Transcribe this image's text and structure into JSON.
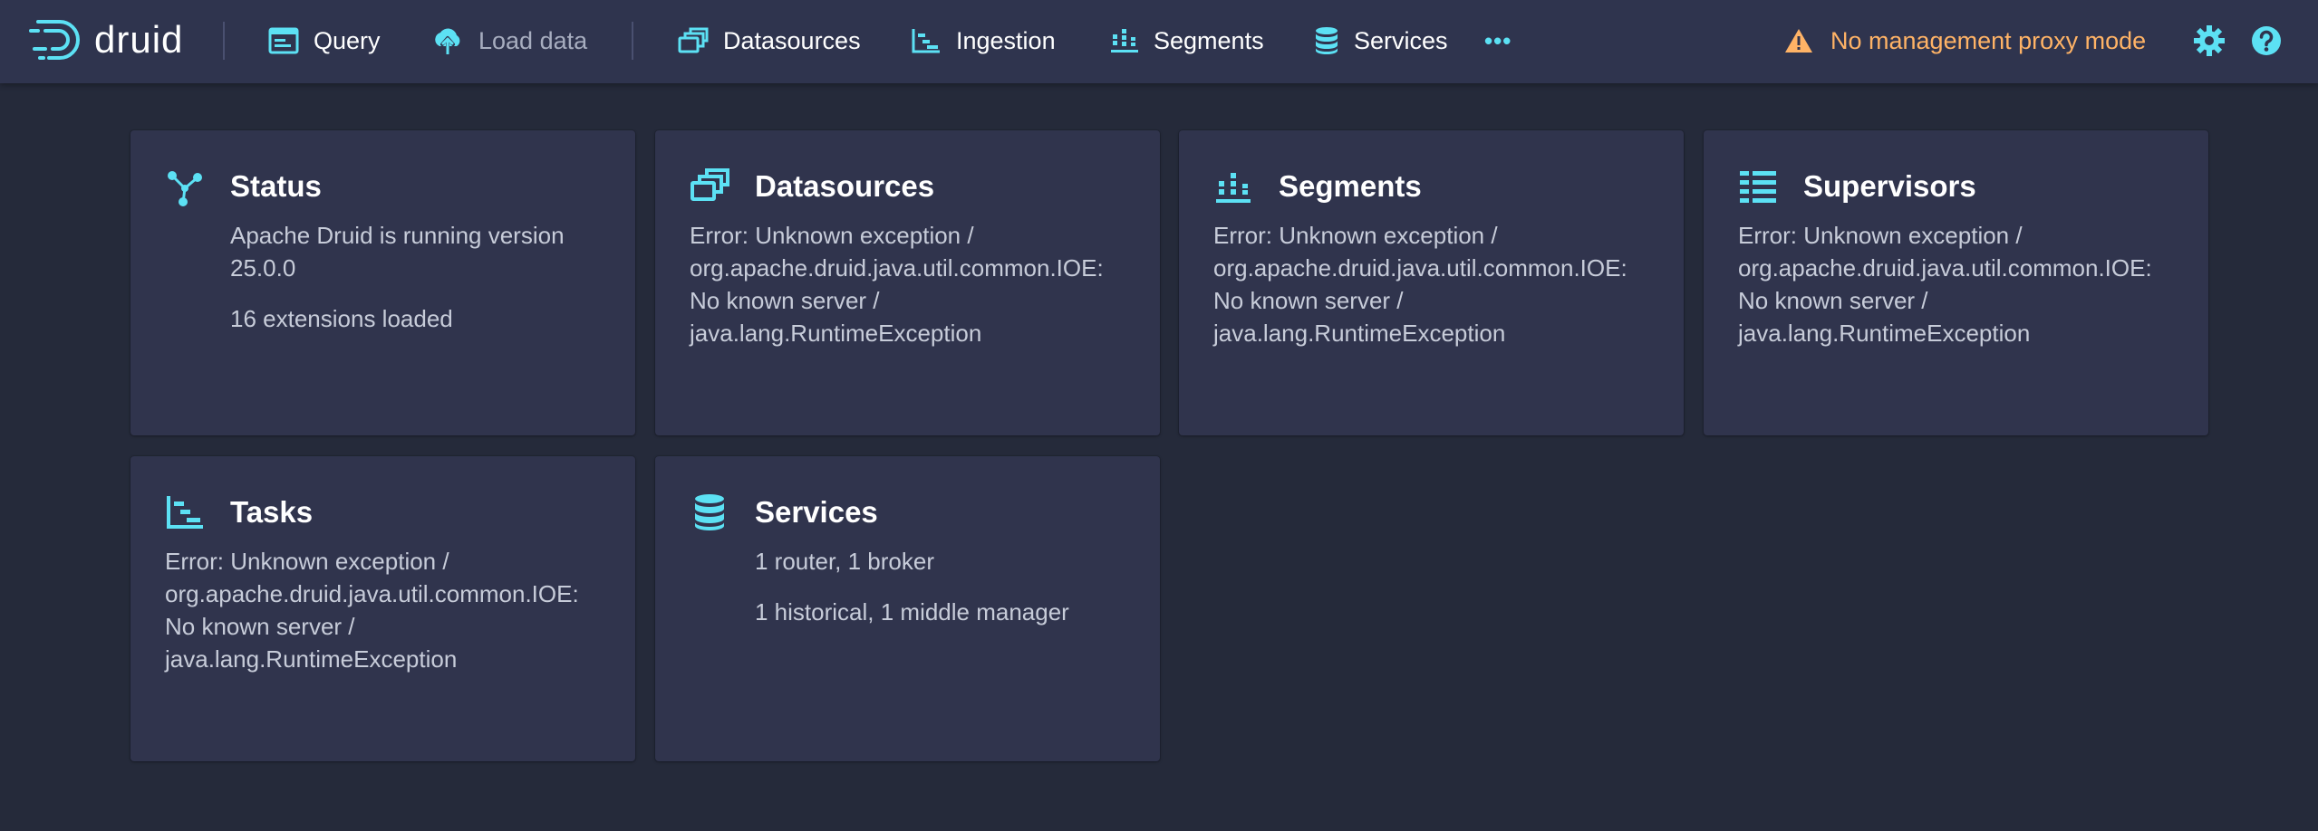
{
  "app": {
    "logo_text": "druid"
  },
  "nav": {
    "query": "Query",
    "load_data": "Load data",
    "datasources": "Datasources",
    "ingestion": "Ingestion",
    "segments": "Segments",
    "services": "Services",
    "more": "•••",
    "proxy_warning": "No management proxy mode"
  },
  "colors": {
    "accent": "#5ce1f4",
    "warning": "#ffb366",
    "background": "#252a3a",
    "navbar": "#2f344e",
    "card": "#30344d"
  },
  "cards": {
    "status": {
      "title": "Status",
      "line1": "Apache Druid is running version 25.0.0",
      "line2": "16 extensions loaded"
    },
    "datasources": {
      "title": "Datasources",
      "error": "Error: Unknown exception / org.apache.druid.java.util.common.IOE: No known server / java.lang.RuntimeException"
    },
    "segments": {
      "title": "Segments",
      "error": "Error: Unknown exception / org.apache.druid.java.util.common.IOE: No known server / java.lang.RuntimeException"
    },
    "supervisors": {
      "title": "Supervisors",
      "error": "Error: Unknown exception / org.apache.druid.java.util.common.IOE: No known server / java.lang.RuntimeException"
    },
    "tasks": {
      "title": "Tasks",
      "error": "Error: Unknown exception / org.apache.druid.java.util.common.IOE: No known server / java.lang.RuntimeException"
    },
    "services": {
      "title": "Services",
      "line1": "1 router, 1 broker",
      "line2": "1 historical, 1 middle manager"
    }
  }
}
